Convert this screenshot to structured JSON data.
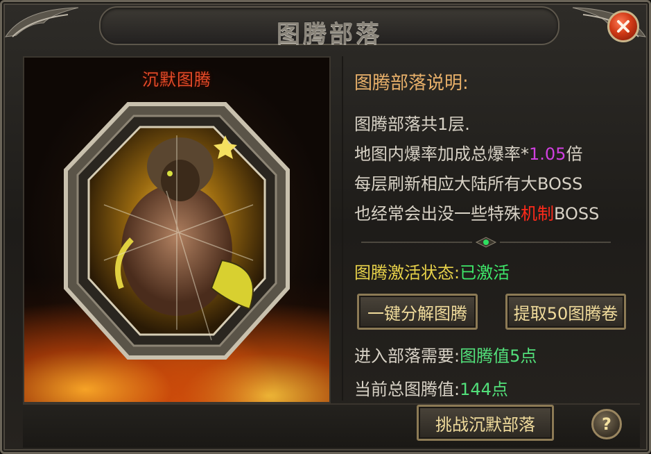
{
  "window": {
    "title": "图腾部落",
    "close_icon": "close-x-icon"
  },
  "totem": {
    "name": "沉默图腾",
    "image": "warrior-totem-portrait"
  },
  "info": {
    "heading": "图腾部落说明:",
    "line1": "图腾部落共1层.",
    "line2_prefix": "地图内爆率加成总爆率*",
    "line2_value": "1.05",
    "line2_suffix": "倍",
    "line3": "每层刷新相应大陆所有大BOSS",
    "line4_prefix": "也经常会出没一些特殊",
    "line4_highlight": "机制",
    "line4_suffix": "BOSS"
  },
  "status": {
    "label": "图腾激活状态:",
    "value": "已激活"
  },
  "buttons": {
    "decompose": "一键分解图腾",
    "extract": "提取50图腾卷",
    "challenge": "挑战沉默部落",
    "help": "?"
  },
  "requirement": {
    "label": "进入部落需要:",
    "value": "图腾值5点"
  },
  "current": {
    "label": "当前总图腾值:",
    "value": "144点"
  },
  "colors": {
    "accent_gold": "#f1dc9c",
    "status_green": "#3ee86a",
    "highlight_magenta": "#d040e0",
    "highlight_red": "#ff2a1a",
    "totem_name_red": "#e24a28"
  }
}
